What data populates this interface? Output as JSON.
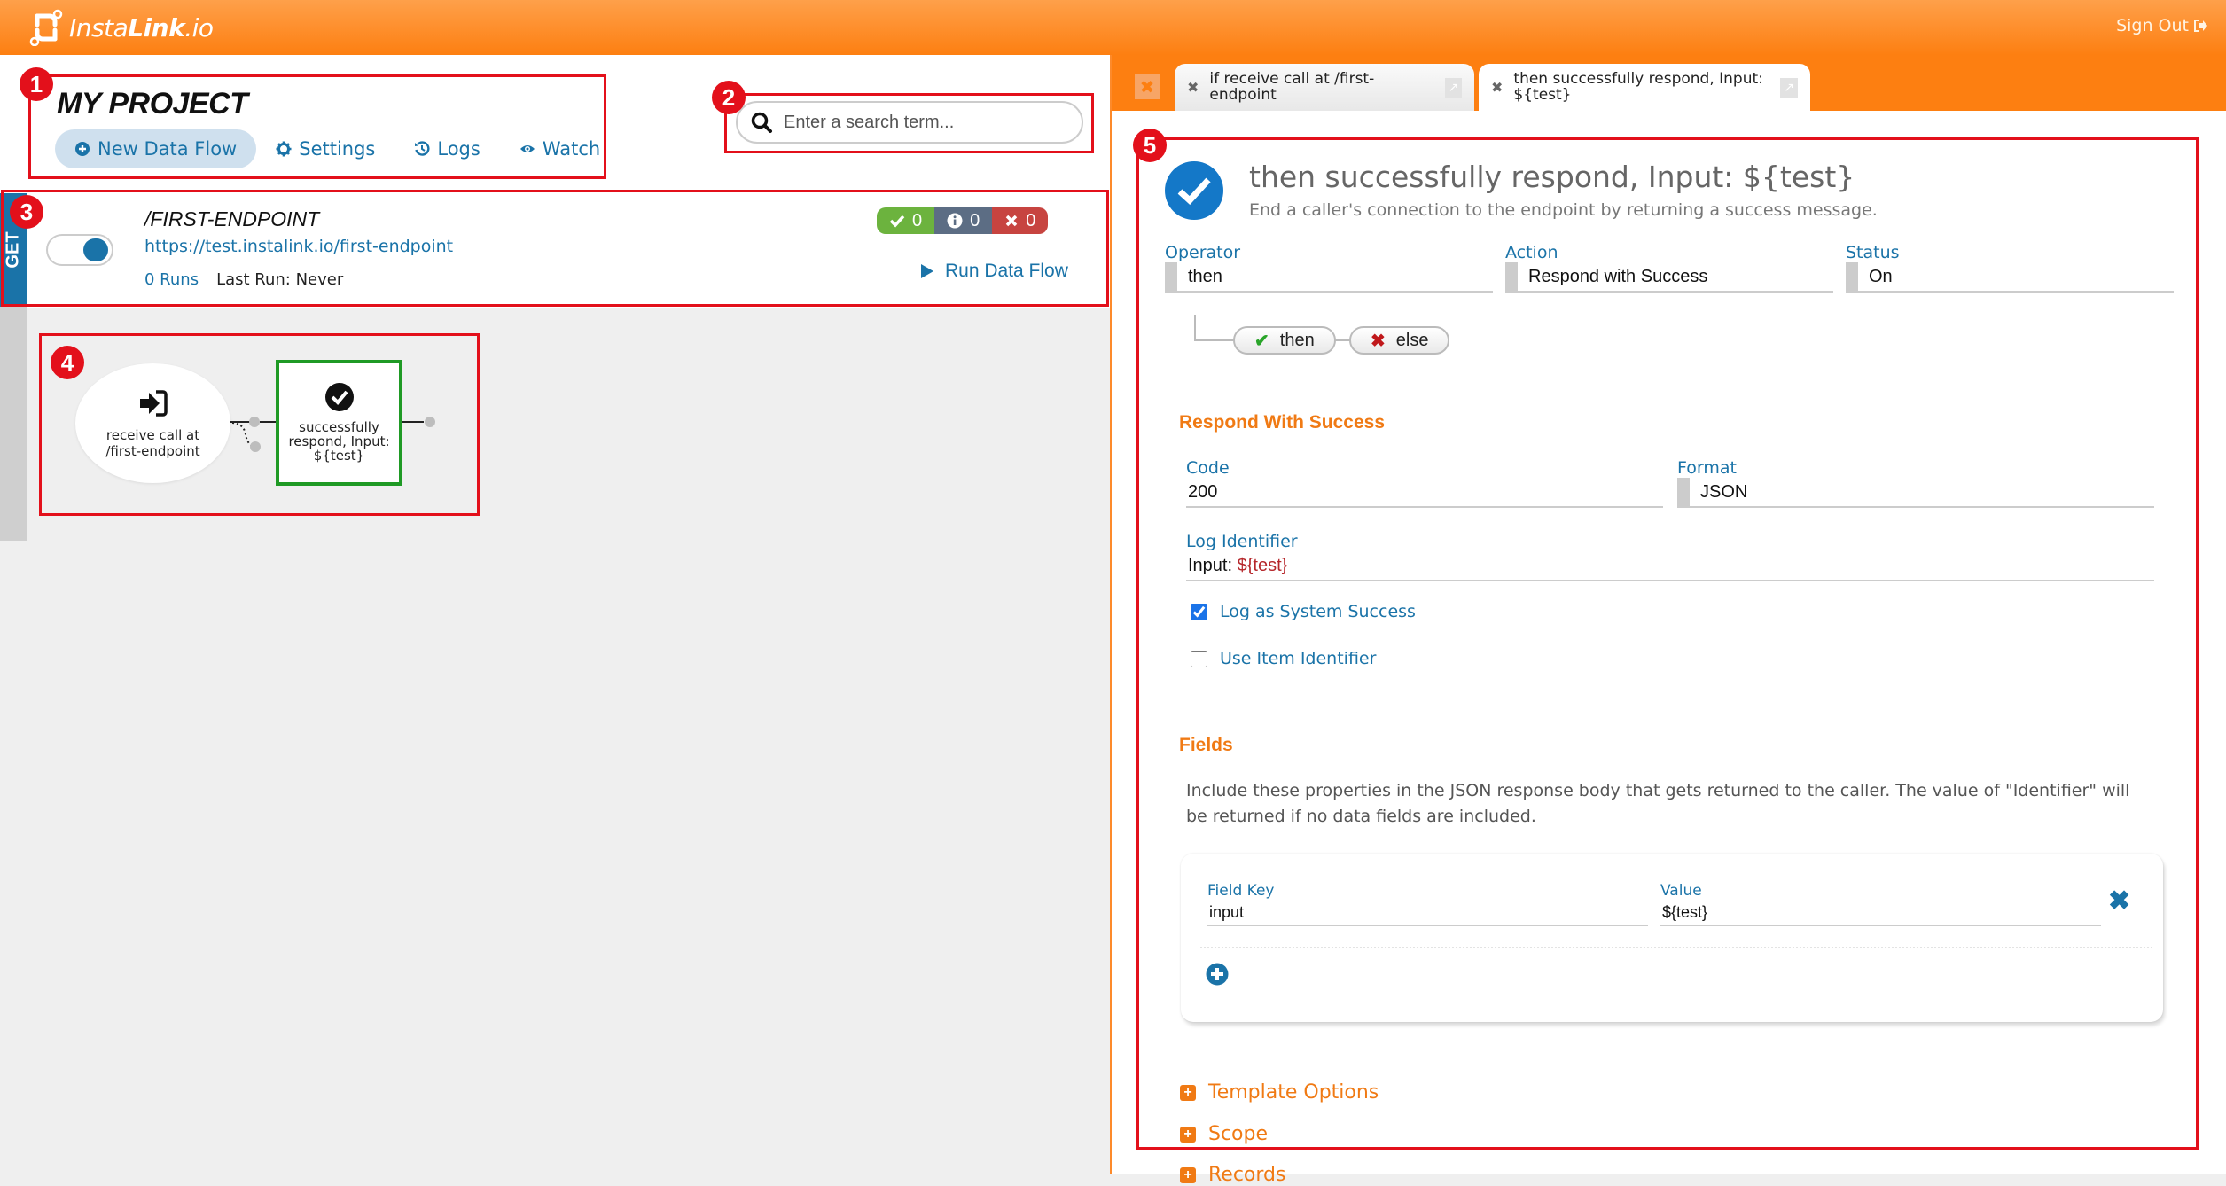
{
  "header": {
    "logo_text_light": "Insta",
    "logo_text_bold": "Link",
    "logo_text_suffix": ".io",
    "sign_out_label": "Sign Out"
  },
  "annotations": [
    "1",
    "2",
    "3",
    "4",
    "5"
  ],
  "project": {
    "title": "MY PROJECT",
    "nav": [
      {
        "label": "New Data Flow",
        "icon": "plus-circle-icon",
        "active": true
      },
      {
        "label": "Settings",
        "icon": "gear-icon"
      },
      {
        "label": "Logs",
        "icon": "history-icon"
      },
      {
        "label": "Watch",
        "icon": "eye-icon"
      }
    ]
  },
  "search": {
    "placeholder": "Enter a search term...",
    "value": ""
  },
  "endpoint": {
    "method": "GET",
    "enabled": true,
    "title": "/FIRST-ENDPOINT",
    "url": "https://test.instalink.io/first-endpoint",
    "runs": "0 Runs",
    "last_run": "Last Run: Never",
    "stats": {
      "success": "0",
      "info": "0",
      "error": "0"
    },
    "run_label": "Run Data Flow"
  },
  "flow": {
    "nodes": [
      {
        "label_line1": "receive call at",
        "label_line2": "/first-endpoint",
        "icon": "sign-in-icon",
        "shape": "oval"
      },
      {
        "label_line1": "successfully",
        "label_line2": "respond, Input:",
        "label_line3": "${test}",
        "icon": "check-circle-icon",
        "shape": "box",
        "selected": true
      }
    ]
  },
  "tabs": [
    {
      "label": "if receive call at /first-endpoint",
      "active": false
    },
    {
      "label_line1": "then successfully respond, Input:",
      "label_line2": "${test}",
      "active": true
    }
  ],
  "detail": {
    "title": "then successfully respond, Input: ${test}",
    "subtitle": "End a caller's connection to the endpoint by returning a success message.",
    "operator": {
      "label": "Operator",
      "value": "then"
    },
    "action": {
      "label": "Action",
      "value": "Respond with Success"
    },
    "status": {
      "label": "Status",
      "value": "On"
    },
    "branches": {
      "then": "then",
      "else": "else"
    },
    "respond_section": {
      "title": "Respond With Success",
      "code": {
        "label": "Code",
        "value": "200"
      },
      "format": {
        "label": "Format",
        "value": "JSON"
      },
      "log_identifier": {
        "label": "Log Identifier",
        "prefix": "Input: ",
        "variable": "${test}"
      },
      "log_as_system_success": {
        "label": "Log as System Success",
        "checked": true
      },
      "use_item_identifier": {
        "label": "Use Item Identifier",
        "checked": false
      }
    },
    "fields_section": {
      "title": "Fields",
      "description": "Include these properties in the JSON response body that gets returned to the caller. The value of \"Identifier\" will be returned if no data fields are included.",
      "rows": [
        {
          "key_label": "Field Key",
          "key": "input",
          "value_label": "Value",
          "value": "${test}"
        }
      ]
    },
    "collapsed_sections": [
      "Template Options",
      "Scope",
      "Records"
    ]
  }
}
